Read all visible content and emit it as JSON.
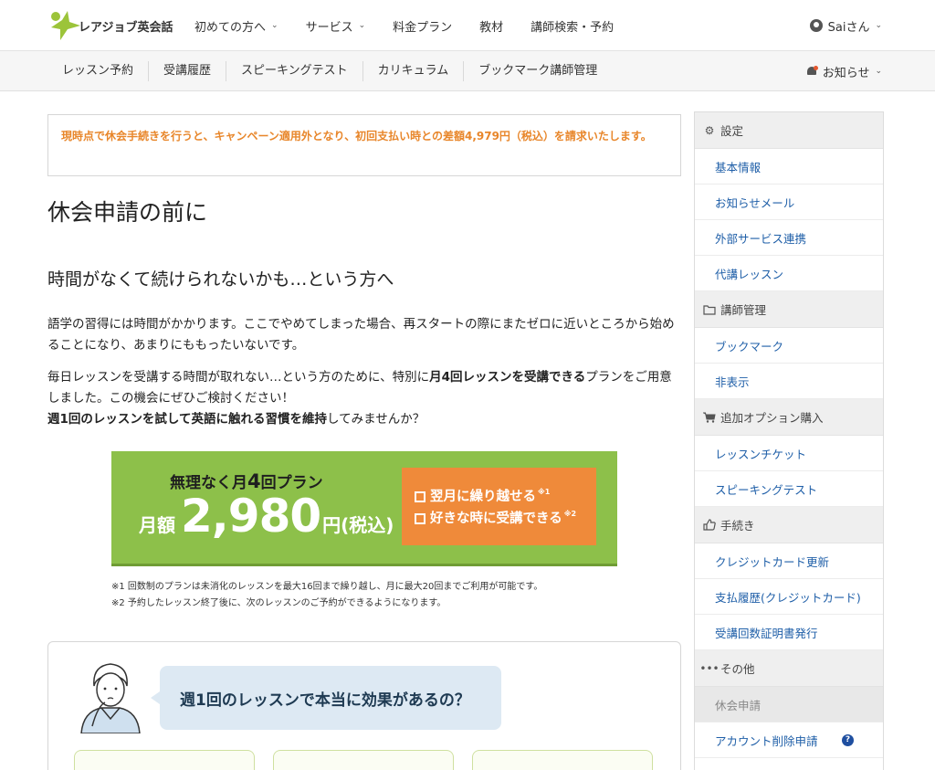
{
  "header": {
    "logo_text": "レアジョブ英会話",
    "nav": [
      {
        "label": "初めての方へ",
        "dropdown": true
      },
      {
        "label": "サービス",
        "dropdown": true
      },
      {
        "label": "料金プラン",
        "dropdown": false
      },
      {
        "label": "教材",
        "dropdown": false
      },
      {
        "label": "講師検索・予約",
        "dropdown": false
      }
    ],
    "user_label": "Saiさん"
  },
  "subnav": {
    "items": [
      "レッスン予約",
      "受講履歴",
      "スピーキングテスト",
      "カリキュラム",
      "ブックマーク講師管理"
    ],
    "notice_label": "お知らせ"
  },
  "main": {
    "alert": "現時点で休会手続きを行うと、キャンペーン適用外となり、初回支払い時との差額4,979円（税込）を請求いたします。",
    "page_title": "休会申請の前に",
    "section_title": "時間がなくて続けられないかも…という方へ",
    "para1": "語学の習得には時間がかかります。ここでやめてしまった場合、再スタートの際にまたゼロに近いところから始めることになり、あまりにももったいないです。",
    "para2_a": "毎日レッスンを受講する時間が取れない…という方のために、特別に",
    "para2_b": "月4回レッスンを受講できる",
    "para2_c": "プランをご用意しました。この機会にぜひご検討ください！",
    "para3_a": "週1回のレッスンを試して英語に触れる習慣を維持",
    "para3_b": "してみませんか？"
  },
  "banner": {
    "title_a": "無理なく月",
    "title_num": "4",
    "title_b": "回プラン",
    "price_label": "月額",
    "price": "2,980",
    "price_unit": "円(税込)",
    "feature1": "翌月に繰り越せる",
    "feature1_sup": "※1",
    "feature2": "好きな時に受講できる",
    "feature2_sup": "※2",
    "note1": "※1 回数制のプランは未消化のレッスンを最大16回まで繰り越し、月に最大20回までご利用が可能です。",
    "note2": "※2 予約したレッスン終了後に、次のレッスンのご予約ができるようになります。"
  },
  "card": {
    "bubble": "週1回のレッスンで本当に効果があるの？"
  },
  "sidebar": {
    "sections": [
      {
        "title": "設定",
        "icon": "gear-icon",
        "items": [
          "基本情報",
          "お知らせメール",
          "外部サービス連携",
          "代講レッスン"
        ]
      },
      {
        "title": "講師管理",
        "icon": "folder-icon",
        "items": [
          "ブックマーク",
          "非表示"
        ]
      },
      {
        "title": "追加オプション購入",
        "icon": "cart-icon",
        "items": [
          "レッスンチケット",
          "スピーキングテスト"
        ]
      },
      {
        "title": "手続き",
        "icon": "thumbs-up-icon",
        "items": [
          "クレジットカード更新",
          "支払履歴(クレジットカード)",
          "受講回数証明書発行"
        ]
      },
      {
        "title": "その他",
        "icon": "ellipsis-icon",
        "items": [
          "休会申請",
          "アカウント削除申請"
        ]
      }
    ],
    "active_item": "休会申請",
    "help_icon_text": "?"
  },
  "colors": {
    "alert": "#e8862a",
    "link": "#1f5fa8",
    "banner_green": "#8dc04a",
    "banner_orange": "#ef8a3a",
    "logo_green": "#9cc43a"
  }
}
